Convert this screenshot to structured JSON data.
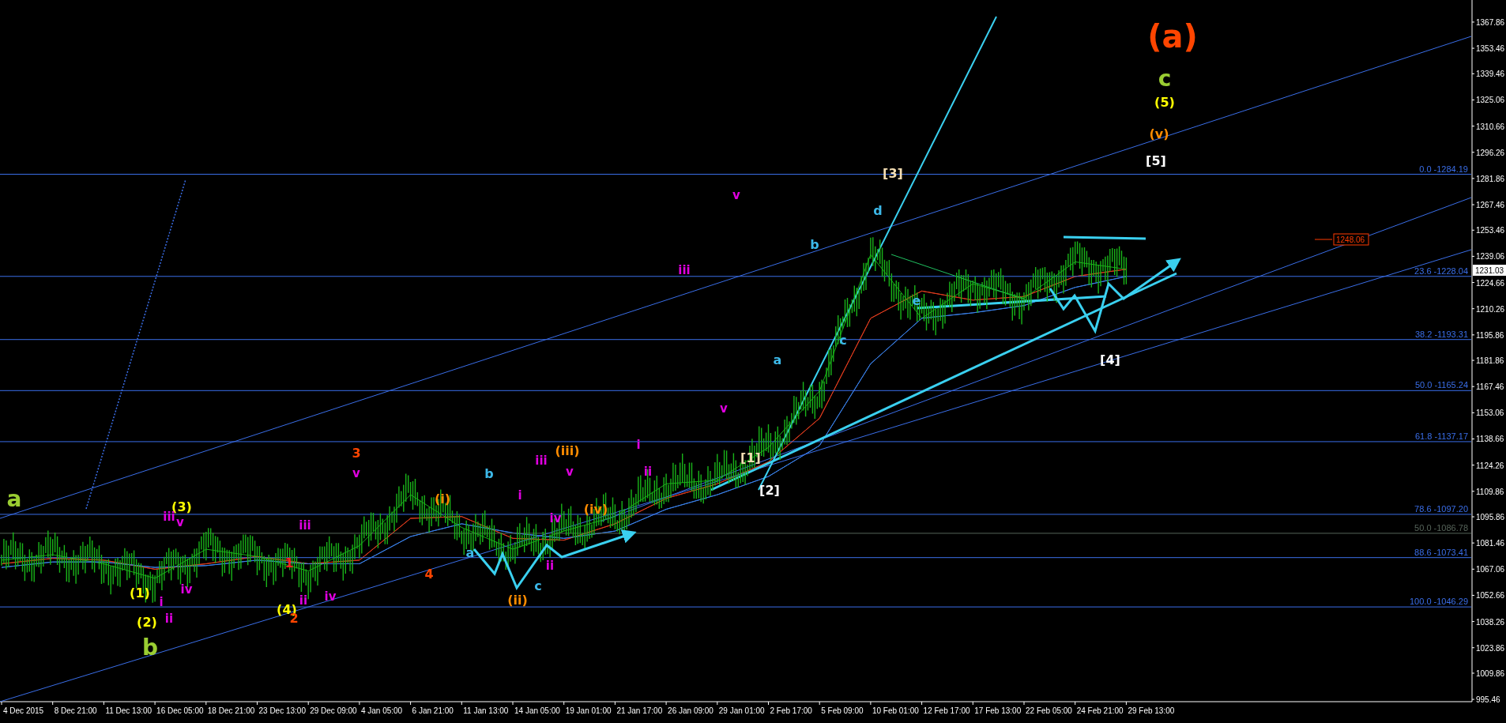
{
  "chart": {
    "chart_data": {
      "type": "line",
      "categories": [
        "4 Dec 2015",
        "8 Dec 21:00",
        "11 Dec 13:00",
        "16 Dec 05:00",
        "18 Dec 21:00",
        "23 Dec 13:00",
        "29 Dec 09:00",
        "4 Jan 05:00",
        "6 Jan 21:00",
        "11 Jan 13:00",
        "14 Jan 05:00",
        "19 Jan 01:00",
        "21 Jan 17:00",
        "26 Jan 09:00",
        "29 Jan 01:00",
        "2 Feb 17:00",
        "5 Feb 09:00",
        "10 Feb 01:00",
        "12 Feb 17:00",
        "17 Feb 13:00",
        "22 Feb 05:00",
        "24 Feb 21:00",
        "29 Feb 13:00"
      ],
      "series": [
        {
          "color": "#19b419",
          "values": [
            1072,
            1075,
            1070,
            1062,
            1078,
            1074,
            1066,
            1080,
            1108,
            1090,
            1078,
            1088,
            1096,
            1114,
            1116,
            1134,
            1165,
            1240,
            1205,
            1224,
            1216,
            1236,
            1232
          ]
        },
        {
          "color": "#e03c1e",
          "values": [
            1070,
            1073,
            1072,
            1067,
            1070,
            1074,
            1070,
            1072,
            1095,
            1096,
            1084,
            1083,
            1092,
            1106,
            1114,
            1126,
            1150,
            1205,
            1220,
            1215,
            1217,
            1228,
            1232
          ]
        },
        {
          "color": "#3a80e8",
          "values": [
            1068,
            1071,
            1071,
            1068,
            1069,
            1072,
            1070,
            1070,
            1085,
            1092,
            1087,
            1084,
            1088,
            1100,
            1108,
            1118,
            1135,
            1180,
            1205,
            1208,
            1212,
            1222,
            1228
          ]
        }
      ],
      "ylim": [
        994.2,
        1380.0
      ],
      "yticks": [
        1367.86,
        1353.46,
        1339.46,
        1325.06,
        1310.66,
        1296.26,
        1281.86,
        1267.46,
        1253.46,
        1239.06,
        1224.66,
        1210.26,
        1195.86,
        1181.86,
        1167.46,
        1153.06,
        1138.66,
        1124.26,
        1109.86,
        1095.86,
        1081.46,
        1067.06,
        1052.66,
        1038.26,
        1023.86,
        1009.86,
        995.46
      ]
    },
    "fib_levels": [
      {
        "label": "0.0 -1284.19",
        "color": "#3a6ee8"
      },
      {
        "label": "23.6 -1228.04",
        "color": "#3a6ee8"
      },
      {
        "label": "38.2 -1193.31",
        "color": "#3a6ee8"
      },
      {
        "label": "50.0 -1165.24",
        "color": "#3a6ee8"
      },
      {
        "label": "61.8 -1137.17",
        "color": "#3a6ee8"
      },
      {
        "label": "78.6 -1097.20",
        "color": "#3a6ee8"
      },
      {
        "label": "50.0 -1086.78",
        "color": "#56645a"
      },
      {
        "label": "88.6 -1073.41",
        "color": "#3a6ee8"
      },
      {
        "label": "100.0 -1046.29",
        "color": "#3a6ee8"
      }
    ],
    "current_price": "1231.03",
    "price_label": "1248.06",
    "wave_labels": [
      {
        "kind": "cycle",
        "text": "(a)",
        "color": "#ff4500"
      },
      {
        "kind": "primary",
        "text": "c",
        "color": "#9acd32"
      },
      {
        "kind": "primary",
        "text": "a",
        "color": "#9acd32"
      },
      {
        "kind": "primary",
        "text": "b",
        "color": "#9acd32"
      },
      {
        "kind": "wave",
        "text": "(5)",
        "color": "#ffff00"
      },
      {
        "kind": "wave",
        "text": "(v)",
        "color": "#ff8c00"
      },
      {
        "kind": "wave",
        "text": "[5]",
        "color": "#ffffff"
      },
      {
        "kind": "wave",
        "text": "[4]",
        "color": "#ffffff"
      },
      {
        "kind": "wave",
        "text": "[3]",
        "color": "#f5deb3"
      },
      {
        "kind": "wave",
        "text": "[1]",
        "color": "#f5deb3"
      },
      {
        "kind": "wave",
        "text": "[2]",
        "color": "#ffffff"
      },
      {
        "kind": "wave",
        "text": "(1)",
        "color": "#ffff00"
      },
      {
        "kind": "wave",
        "text": "(2)",
        "color": "#ffff00"
      },
      {
        "kind": "wave",
        "text": "(3)",
        "color": "#ffff00"
      },
      {
        "kind": "wave",
        "text": "(4)",
        "color": "#ffff00"
      },
      {
        "kind": "wave",
        "text": "3",
        "color": "#ff4500"
      },
      {
        "kind": "wave",
        "text": "2",
        "color": "#ff4500"
      },
      {
        "kind": "wave",
        "text": "1",
        "color": "#ff2020"
      },
      {
        "kind": "wave",
        "text": "4",
        "color": "#ff4500"
      },
      {
        "kind": "wave",
        "text": "(i)",
        "color": "#ff8c00"
      },
      {
        "kind": "wave",
        "text": "(ii)",
        "color": "#ff8c00"
      },
      {
        "kind": "wave",
        "text": "(iii)",
        "color": "#ff8c00"
      },
      {
        "kind": "wave",
        "text": "(iv)",
        "color": "#ff8c00"
      },
      {
        "kind": "minor",
        "text": "v",
        "color": "#e000e0"
      },
      {
        "kind": "minor",
        "text": "iii",
        "color": "#e000e0"
      },
      {
        "kind": "minor",
        "text": "i",
        "color": "#e000e0"
      },
      {
        "kind": "minor",
        "text": "iv",
        "color": "#e000e0"
      },
      {
        "kind": "minor",
        "text": "ii",
        "color": "#e000e0"
      },
      {
        "kind": "minor",
        "text": "iii",
        "color": "#e000e0"
      },
      {
        "kind": "minor",
        "text": "ii",
        "color": "#e000e0"
      },
      {
        "kind": "minor",
        "text": "iv",
        "color": "#e000e0"
      },
      {
        "kind": "minor",
        "text": "v",
        "color": "#e000e0"
      },
      {
        "kind": "minor",
        "text": "i",
        "color": "#e000e0"
      },
      {
        "kind": "minor",
        "text": "ii",
        "color": "#e000e0"
      },
      {
        "kind": "minor",
        "text": "iii",
        "color": "#e000e0"
      },
      {
        "kind": "minor",
        "text": "iv",
        "color": "#e000e0"
      },
      {
        "kind": "minor",
        "text": "v",
        "color": "#e000e0"
      },
      {
        "kind": "minor",
        "text": "i",
        "color": "#e000e0"
      },
      {
        "kind": "minor",
        "text": "ii",
        "color": "#e000e0"
      },
      {
        "kind": "minor",
        "text": "iii",
        "color": "#e000e0"
      },
      {
        "kind": "minor",
        "text": "v",
        "color": "#e000e0"
      },
      {
        "kind": "minor",
        "text": "v",
        "color": "#e000e0"
      },
      {
        "kind": "wave",
        "text": "b",
        "color": "#3cb8e8"
      },
      {
        "kind": "wave",
        "text": "a",
        "color": "#3cb8e8"
      },
      {
        "kind": "wave",
        "text": "c",
        "color": "#3cb8e8"
      },
      {
        "kind": "wave",
        "text": "a",
        "color": "#3cb8e8"
      },
      {
        "kind": "wave",
        "text": "b",
        "color": "#3cb8e8"
      },
      {
        "kind": "wave",
        "text": "c",
        "color": "#3cb8e8"
      },
      {
        "kind": "wave",
        "text": "d",
        "color": "#3cb8e8"
      },
      {
        "kind": "wave",
        "text": "e",
        "color": "#3cb8e8"
      }
    ]
  }
}
